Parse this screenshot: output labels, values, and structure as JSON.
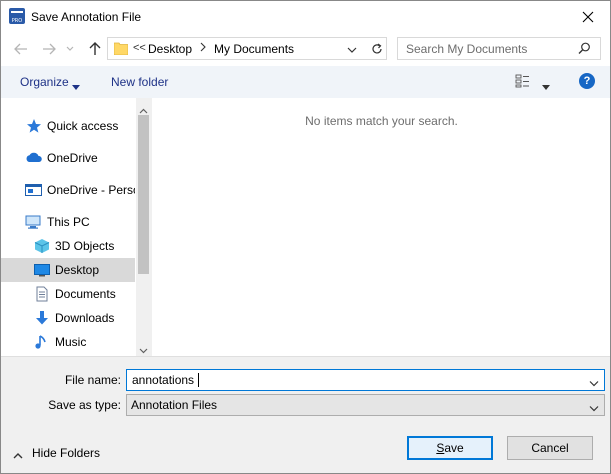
{
  "window": {
    "title": "Save Annotation File",
    "app_icon_text": "PRO",
    "close_icon": "close-icon"
  },
  "nav": {
    "back_icon": "back-arrow-icon",
    "forward_icon": "forward-arrow-icon",
    "recent_icon": "chevron-down-icon",
    "up_icon": "up-arrow-icon"
  },
  "address": {
    "overflow": "<<",
    "segments": [
      "Desktop",
      "My Documents"
    ],
    "refresh_icon": "refresh-icon"
  },
  "search": {
    "placeholder": "Search My Documents",
    "icon": "search-icon"
  },
  "toolbar": {
    "organize_label": "Organize",
    "new_folder_label": "New folder",
    "view_icon": "view-options-icon",
    "help_label": "?"
  },
  "sidebar": {
    "items": [
      {
        "label": "Quick access",
        "icon": "star-icon"
      },
      {
        "label": "OneDrive",
        "icon": "cloud-icon"
      },
      {
        "label": "OneDrive - Perso",
        "icon": "onedrive-business-icon"
      },
      {
        "label": "This PC",
        "icon": "computer-icon"
      },
      {
        "label": "3D Objects",
        "icon": "cube-icon"
      },
      {
        "label": "Desktop",
        "icon": "desktop-icon",
        "selected": true
      },
      {
        "label": "Documents",
        "icon": "document-icon"
      },
      {
        "label": "Downloads",
        "icon": "download-icon"
      },
      {
        "label": "Music",
        "icon": "music-icon"
      }
    ]
  },
  "content": {
    "empty_message": "No items match your search."
  },
  "form": {
    "file_name_label": "File name:",
    "file_name_value": "annotations",
    "save_type_label": "Save as type:",
    "save_type_value": "Annotation Files"
  },
  "footer": {
    "hide_folders_label": "Hide Folders",
    "save_label": "Save",
    "cancel_label": "Cancel"
  },
  "colors": {
    "accent": "#0078d7",
    "link_text": "#1e3287",
    "selected_bg": "#d9d9d9",
    "help": "#1767c5"
  }
}
